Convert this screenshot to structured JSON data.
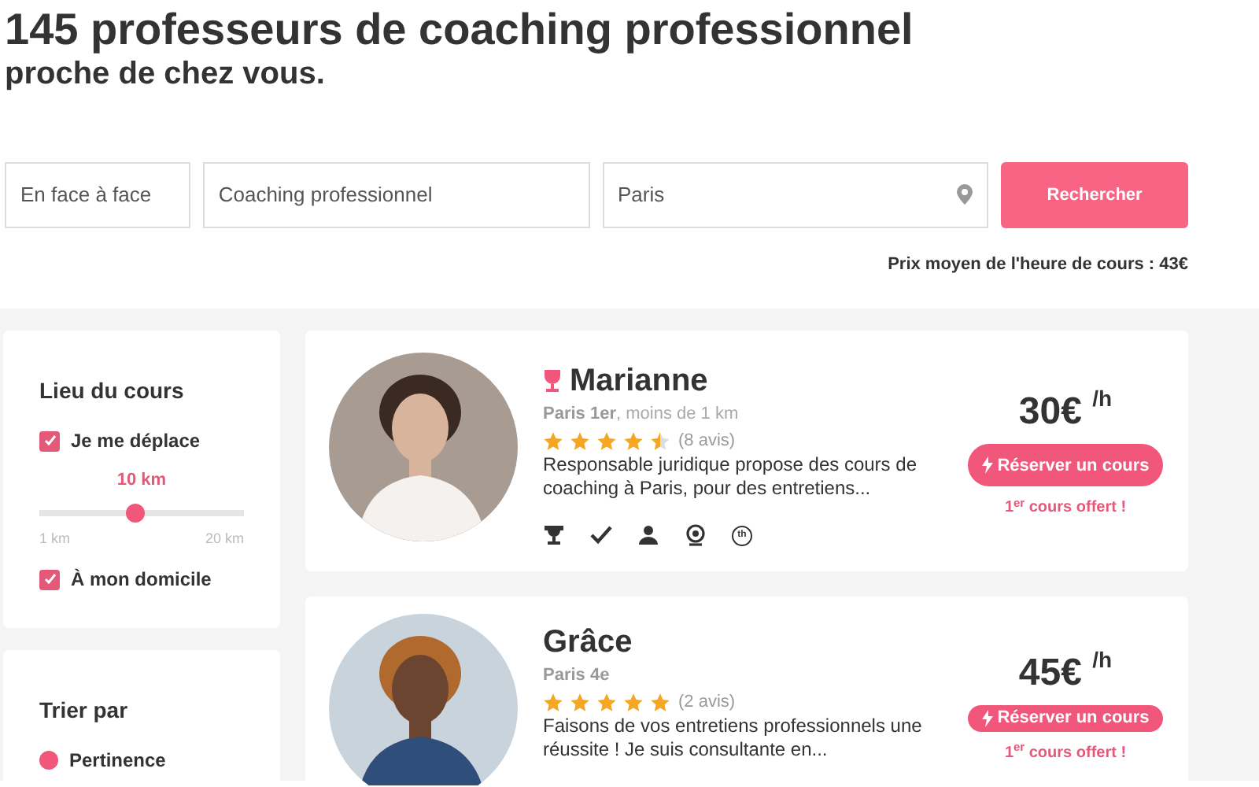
{
  "heading": {
    "title": "145 professeurs de coaching professionnel",
    "subtitle": "proche de chez vous."
  },
  "search": {
    "mode": "En face à face",
    "subject": "Coaching professionnel",
    "location": "Paris",
    "button": "Rechercher"
  },
  "average_price": "Prix moyen de l'heure de cours : 43€",
  "filters": {
    "title": "Lieu du cours",
    "options": [
      {
        "label": "Je me déplace",
        "checked": true
      },
      {
        "label": "À mon domicile",
        "checked": true
      }
    ],
    "distance": {
      "reading": "10 km",
      "min": "1 km",
      "max": "20 km",
      "level": 0.47
    }
  },
  "sort": {
    "title": "Trier par",
    "options": [
      {
        "label": "Pertinence",
        "selected": true
      }
    ]
  },
  "teachers": [
    {
      "name": "Marianne",
      "top_teacher": true,
      "area": "Paris 1er",
      "distance": ", moins de 1 km",
      "stars": 4.5,
      "reviews": "(8 avis)",
      "description": "Responsable juridique propose des cours de coaching à Paris, pour des entretiens...",
      "badge_text": "th",
      "price": "30€",
      "unit": "/h",
      "book": "Réserver un cours",
      "offer": "1$^{er}$ cours offert !"
    },
    {
      "name": "Grâce",
      "top_teacher": false,
      "area": "Paris 4e",
      "stars": 5,
      "reviews": "(2 avis)",
      "description": "Faisons de vos entretiens professionnels une réussite ! Je suis consultante en...",
      "price": "45€",
      "unit": "/h",
      "book": "Réserver un cours",
      "offer": "1$^{er}$ cours offert !"
    }
  ]
}
